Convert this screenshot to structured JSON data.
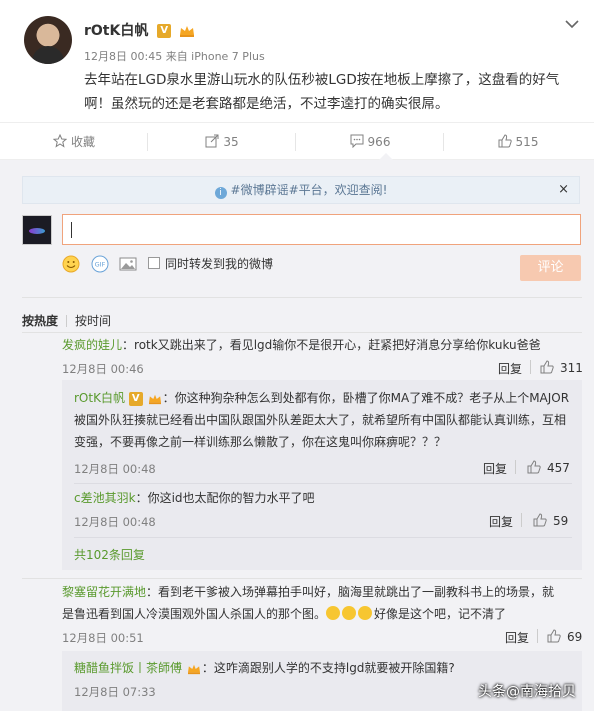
{
  "post": {
    "author": "rOtK白帆",
    "verified_badge": "V",
    "meta": "12月8日 00:45 来自 iPhone 7 Plus",
    "text": "去年站在LGD泉水里游山玩水的队伍秒被LGD按在地板上摩擦了，这盘看的好气啊！虽然玩的还是老套路都是绝活，不过李逵打的确实很屌。"
  },
  "actions": {
    "favorite": "收藏",
    "repost": "35",
    "comment": "966",
    "like": "515"
  },
  "comment_box": {
    "notice": "#微博辟谣#平台，欢迎查阅!",
    "close": "×",
    "repost_checkbox_label": "同时转发到我的微博",
    "submit": "评论"
  },
  "sort": {
    "hot": "按热度",
    "time": "按时间"
  },
  "comments": [
    {
      "user": "发疯的娃儿",
      "text": "rotk又跳出来了，看见lgd输你不是很开心，赶紧把好消息分享给你kuku爸爸",
      "time": "12月8日 00:46",
      "reply": "回复",
      "likes": "311",
      "replies": [
        {
          "user": "rOtK白帆",
          "text_line1": "你这种狗杂种怎么到处都有你，卧槽了你MA了难不成？老子从上个MAJOR",
          "text_line2": "被国外队狂揍就已经看出中国队跟国外队差距太大了，就希望所有中国队都能认真训练，互相",
          "text_line3": "变强，不要再像之前一样训练那么懒散了，你在这鬼叫你麻痹呢？？？",
          "time": "12月8日 00:48",
          "reply": "回复",
          "likes": "457"
        },
        {
          "user": "c差池其羽k",
          "text": "你这id也太配你的智力水平了吧",
          "time": "12月8日 00:48",
          "reply": "回复",
          "likes": "59"
        }
      ],
      "more": "共102条回复"
    },
    {
      "user": "黎塞留花开满地",
      "text_line1": "看到老干爹被入场弹幕拍手叫好，脑海里就跳出了一副教科书上的场景，就",
      "text_line2": "是鲁迅看到国人冷漠围观外国人杀国人的那个图。",
      "text_tail": "好像是这个吧，记不清了",
      "time": "12月8日 00:51",
      "reply": "回复",
      "likes": "69",
      "replies": [
        {
          "user": "糖醋鱼拌饭丨茶師傅",
          "text": "这咋滴跟别人学的不支持lgd就要被开除国籍?",
          "time": "12月8日 07:33"
        }
      ]
    }
  ],
  "watermark": "头条@南海拾贝"
}
